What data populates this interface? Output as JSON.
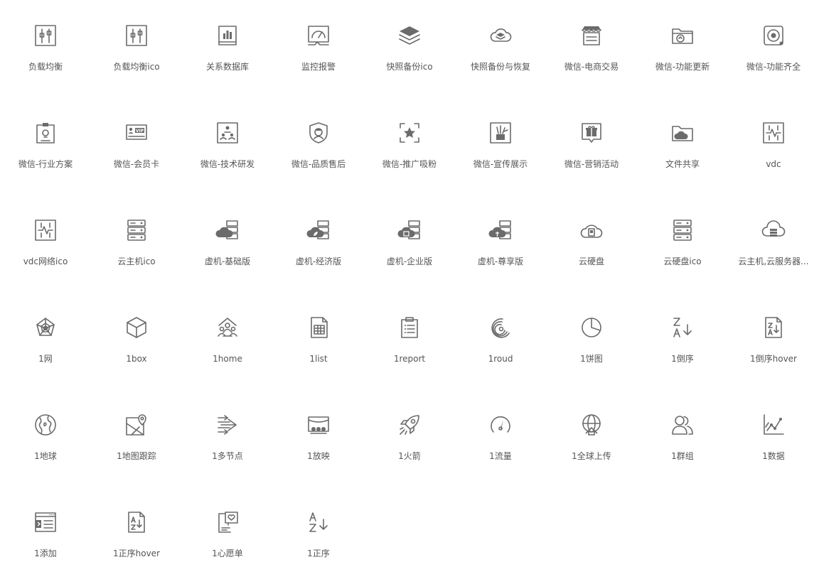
{
  "colors": {
    "icon": "#6b6b6b",
    "label": "#555555",
    "background": "#ffffff"
  },
  "items": [
    {
      "label": "负载均衡",
      "icon": "sliders-icon"
    },
    {
      "label": "负载均衡ico",
      "icon": "sliders-icon"
    },
    {
      "label": "关系数据库",
      "icon": "database-book-icon"
    },
    {
      "label": "监控报警",
      "icon": "monitor-gauge-icon"
    },
    {
      "label": "快照备份ico",
      "icon": "layers-icon"
    },
    {
      "label": "快照备份与恢复",
      "icon": "cloud-layers-icon"
    },
    {
      "label": "微信-电商交易",
      "icon": "storefront-icon"
    },
    {
      "label": "微信-功能更新",
      "icon": "folder-sync-icon"
    },
    {
      "label": "微信-功能齐全",
      "icon": "safe-dial-icon"
    },
    {
      "label": "微信-行业方案",
      "icon": "clipboard-bulb-icon"
    },
    {
      "label": "微信-会员卡",
      "icon": "vip-card-icon"
    },
    {
      "label": "微信-技术研发",
      "icon": "org-chart-icon"
    },
    {
      "label": "微信-品质售后",
      "icon": "shield-user-icon"
    },
    {
      "label": "微信-推广吸粉",
      "icon": "focus-star-icon"
    },
    {
      "label": "微信-宣传展示",
      "icon": "display-sparkle-icon"
    },
    {
      "label": "微信-营销活动",
      "icon": "gift-bubble-icon"
    },
    {
      "label": "文件共享",
      "icon": "folder-cloud-icon"
    },
    {
      "label": "vdc",
      "icon": "network-board-icon"
    },
    {
      "label": "vdc网络ico",
      "icon": "network-board-icon"
    },
    {
      "label": "云主机ico",
      "icon": "server-stack-icon"
    },
    {
      "label": "虚机-基础版",
      "icon": "cloud-server-icon"
    },
    {
      "label": "虚机-经济版",
      "icon": "cloud-server-leaf-icon"
    },
    {
      "label": "虚机-企业版",
      "icon": "cloud-server-enterprise-icon"
    },
    {
      "label": "虚机-尊享版",
      "icon": "cloud-server-premium-icon"
    },
    {
      "label": "云硬盘",
      "icon": "cloud-chip-icon"
    },
    {
      "label": "云硬盘ico",
      "icon": "server-stack-icon"
    },
    {
      "label": "云主机,云服务器...",
      "icon": "cloud-rack-icon"
    },
    {
      "label": "1网",
      "icon": "radar-web-icon"
    },
    {
      "label": "1box",
      "icon": "box-icon"
    },
    {
      "label": "1home",
      "icon": "home-people-icon"
    },
    {
      "label": "1list",
      "icon": "spreadsheet-icon"
    },
    {
      "label": "1report",
      "icon": "report-clipboard-icon"
    },
    {
      "label": "1roud",
      "icon": "spiral-icon"
    },
    {
      "label": "1饼图",
      "icon": "pie-chart-icon"
    },
    {
      "label": "1倒序",
      "icon": "sort-za-icon"
    },
    {
      "label": "1倒序hover",
      "icon": "file-sort-za-icon"
    },
    {
      "label": "1地球",
      "icon": "globe-icon"
    },
    {
      "label": "1地图跟踪",
      "icon": "map-pin-icon"
    },
    {
      "label": "1多节点",
      "icon": "multi-arrows-icon"
    },
    {
      "label": "1放映",
      "icon": "theater-icon"
    },
    {
      "label": "1火箭",
      "icon": "rocket-icon"
    },
    {
      "label": "1流量",
      "icon": "speedometer-icon"
    },
    {
      "label": "1全球上传",
      "icon": "globe-upload-icon"
    },
    {
      "label": "1群组",
      "icon": "group-icon"
    },
    {
      "label": "1数据",
      "icon": "line-chart-icon"
    },
    {
      "label": "1添加",
      "icon": "window-add-icon"
    },
    {
      "label": "1正序hover",
      "icon": "file-sort-az-icon"
    },
    {
      "label": "1心愿单",
      "icon": "wishlist-icon"
    },
    {
      "label": "1正序",
      "icon": "sort-az-icon"
    }
  ]
}
